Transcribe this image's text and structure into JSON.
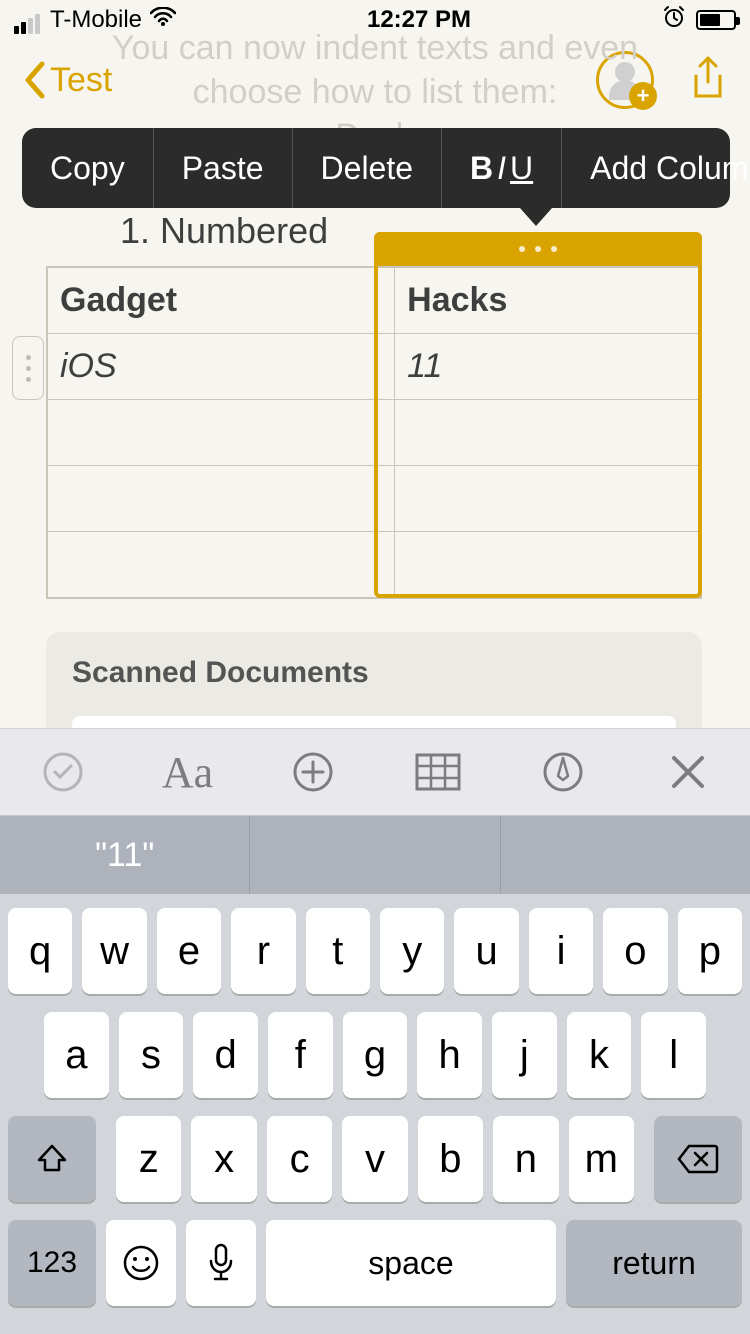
{
  "status": {
    "carrier": "T-Mobile",
    "time": "12:27 PM"
  },
  "nav": {
    "back_label": "Test"
  },
  "bg_line1": "You can now indent texts and even",
  "bg_line2": "choose how to list them:",
  "bg_line3": "Dash",
  "list_item": "1.   Numbered",
  "ctx": {
    "copy": "Copy",
    "paste": "Paste",
    "delete": "Delete",
    "add_col": "Add Column"
  },
  "table": {
    "h1": "Gadget",
    "h2": "Hacks",
    "r1c1": "iOS",
    "r1c2": "11"
  },
  "scanned_title": "Scanned Documents",
  "toolbar_aa": "Aa",
  "predict": {
    "c1": "\"11\""
  },
  "keys": {
    "row1": [
      "q",
      "w",
      "e",
      "r",
      "t",
      "y",
      "u",
      "i",
      "o",
      "p"
    ],
    "row2": [
      "a",
      "s",
      "d",
      "f",
      "g",
      "h",
      "j",
      "k",
      "l"
    ],
    "row3": [
      "z",
      "x",
      "c",
      "v",
      "b",
      "n",
      "m"
    ],
    "num": "123",
    "space": "space",
    "ret": "return"
  }
}
